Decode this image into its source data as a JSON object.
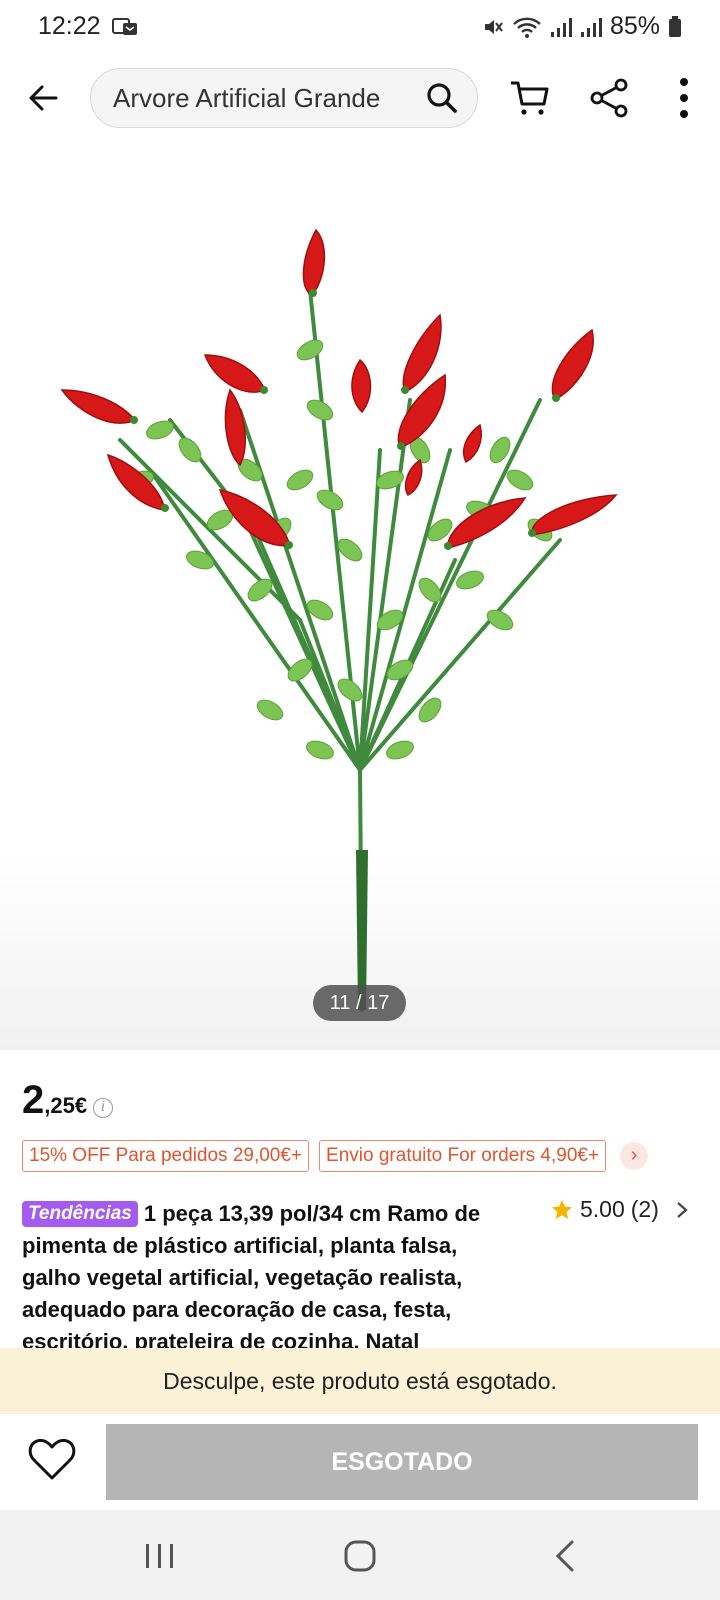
{
  "status": {
    "time": "12:22",
    "battery": "85%"
  },
  "search": {
    "query": "Arvore Artificial Grande"
  },
  "gallery": {
    "counter": "11 / 17"
  },
  "price": {
    "integer": "2",
    "decimal": ",25€",
    "info_symbol": "i"
  },
  "promos": [
    "15% OFF Para pedidos 29,00€+",
    "Envio gratuito For orders 4,90€+"
  ],
  "promo_more": "›",
  "product": {
    "badge": "Tendências",
    "title": "1 peça 13,39 pol/34 cm Ramo de pimenta de plástico artificial, planta falsa, galho vegetal artificial, vegetação realista, adequado para decoração de casa, festa, escritório, prateleira de cozinha, Natal"
  },
  "rating": {
    "score": "5.00",
    "count": "(2)"
  },
  "notice": "Desculpe, este produto está esgotado.",
  "action": {
    "soldout_label": "ESGOTADO"
  },
  "colors": {
    "badge": "#a45cf0",
    "promo": "#e1542e",
    "notice_bg": "#fbf1d6",
    "soldout_btn": "#b5b5b5",
    "star": "#f5b400"
  }
}
